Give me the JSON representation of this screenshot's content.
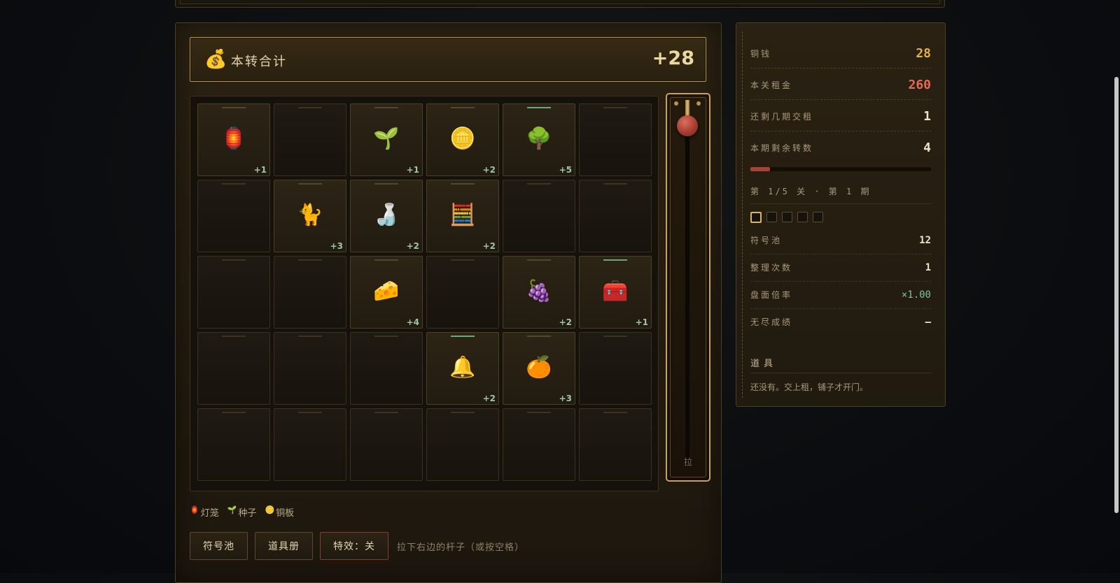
{
  "total": {
    "icon": "money-bag-icon",
    "label": "本转合计",
    "value": "+28"
  },
  "grid": {
    "cells": [
      {
        "sym": "🏮",
        "gain": "+1",
        "name": "lantern",
        "highlight": false
      },
      {
        "sym": "",
        "gain": "",
        "name": "empty",
        "highlight": false
      },
      {
        "sym": "🌱",
        "gain": "+1",
        "name": "seedling",
        "highlight": false
      },
      {
        "sym": "🪙",
        "gain": "+2",
        "name": "copper-plate",
        "highlight": false
      },
      {
        "sym": "🌳",
        "gain": "+5",
        "name": "tree",
        "highlight": true
      },
      {
        "sym": "",
        "gain": "",
        "name": "empty",
        "highlight": false
      },
      {
        "sym": "",
        "gain": "",
        "name": "empty",
        "highlight": false
      },
      {
        "sym": "🐈",
        "gain": "+3",
        "name": "cat",
        "highlight": false
      },
      {
        "sym": "🍶",
        "gain": "+2",
        "name": "sake",
        "highlight": false
      },
      {
        "sym": "🧮",
        "gain": "+2",
        "name": "abacus",
        "highlight": false
      },
      {
        "sym": "",
        "gain": "",
        "name": "empty",
        "highlight": false
      },
      {
        "sym": "",
        "gain": "",
        "name": "empty",
        "highlight": false
      },
      {
        "sym": "",
        "gain": "",
        "name": "empty",
        "highlight": false
      },
      {
        "sym": "",
        "gain": "",
        "name": "empty",
        "highlight": false
      },
      {
        "sym": "🧀",
        "gain": "+4",
        "name": "cheese",
        "highlight": false
      },
      {
        "sym": "",
        "gain": "",
        "name": "empty",
        "highlight": false
      },
      {
        "sym": "🍇",
        "gain": "+2",
        "name": "grapes",
        "highlight": false
      },
      {
        "sym": "🧰",
        "gain": "+1",
        "name": "toolbox",
        "highlight": true
      },
      {
        "sym": "",
        "gain": "",
        "name": "empty",
        "highlight": false
      },
      {
        "sym": "",
        "gain": "",
        "name": "empty",
        "highlight": false
      },
      {
        "sym": "",
        "gain": "",
        "name": "empty",
        "highlight": false
      },
      {
        "sym": "🔔",
        "gain": "+2",
        "name": "bell",
        "highlight": true
      },
      {
        "sym": "🍊",
        "gain": "+3",
        "name": "orange",
        "highlight": false
      },
      {
        "sym": "",
        "gain": "",
        "name": "empty",
        "highlight": false
      },
      {
        "sym": "",
        "gain": "",
        "name": "empty",
        "highlight": false
      },
      {
        "sym": "",
        "gain": "",
        "name": "empty",
        "highlight": false
      },
      {
        "sym": "",
        "gain": "",
        "name": "empty",
        "highlight": false
      },
      {
        "sym": "",
        "gain": "",
        "name": "empty",
        "highlight": false
      },
      {
        "sym": "",
        "gain": "",
        "name": "empty",
        "highlight": false
      },
      {
        "sym": "",
        "gain": "",
        "name": "empty",
        "highlight": false
      }
    ]
  },
  "lever": {
    "label": "拉"
  },
  "legend": [
    {
      "icon": "🏮",
      "label": "灯笼"
    },
    {
      "icon": "🌱",
      "label": "种子"
    },
    {
      "icon": "🪙",
      "label": "铜板"
    }
  ],
  "buttons": {
    "pool": "符号池",
    "items": "道具册",
    "effects": "特效：关",
    "hint": "拉下右边的杆子（或按空格）"
  },
  "stats": {
    "coins_label": "铜钱",
    "coins": "28",
    "rent_label": "本关租金",
    "rent": "260",
    "periods_label": "还剩几期交租",
    "periods": "1",
    "spins_label": "本期剩余转数",
    "spins": "4",
    "rent_progress": 0.108,
    "level": "第 1/5 关 · 第 1 期",
    "pips_total": 5,
    "pips_active": 1,
    "pool_label": "符号池",
    "pool": "12",
    "sort_label": "整理次数",
    "sort": "1",
    "mult_label": "盘面倍率",
    "mult": "×1.00",
    "endless_label": "无尽成绩",
    "endless": "—"
  },
  "items_section": {
    "title": "道具",
    "desc": "还没有。交上租，铺子才开门。"
  },
  "colors": {
    "coins": "#e0b04a",
    "rent": "#e36a56",
    "mult": "#7fc2a0",
    "gold_border": "#b69550"
  }
}
